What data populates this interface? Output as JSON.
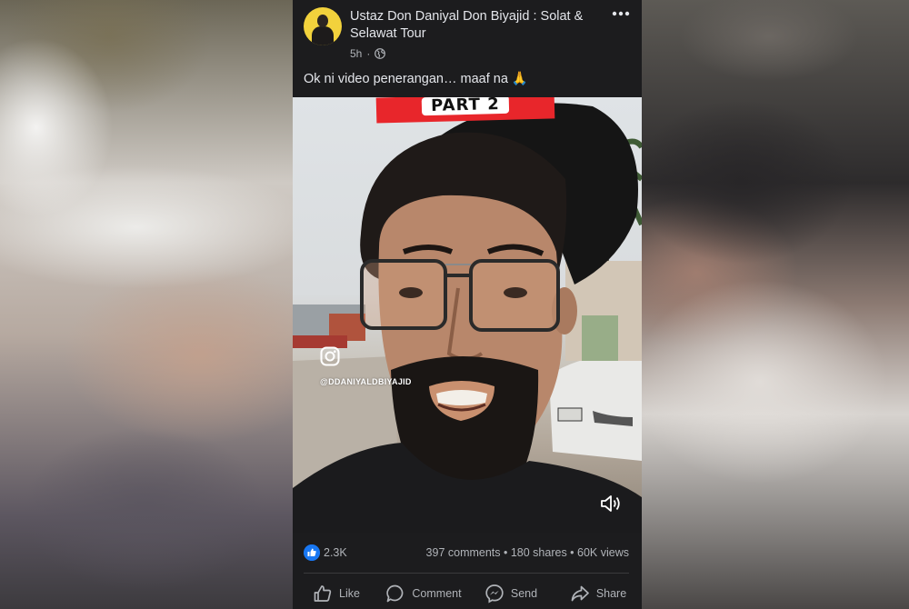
{
  "post": {
    "author": "Ustaz Don Daniyal Don Biyajid : Solat & Selawat Tour",
    "time": "5h",
    "separator": "·",
    "caption": "Ok ni video penerangan… maaf na 🙏",
    "video": {
      "banner_text": "PART 2",
      "overlay_handle": "@DDANIYALDBIYAJID"
    },
    "stats": {
      "reactions": "2.3K",
      "engagement": "397 comments • 180 shares • 60K views"
    },
    "actions": [
      {
        "label": "Like",
        "icon": "thumbs-up-icon"
      },
      {
        "label": "Comment",
        "icon": "comment-icon"
      },
      {
        "label": "Send",
        "icon": "messenger-icon"
      },
      {
        "label": "Share",
        "icon": "share-icon"
      }
    ]
  },
  "colors": {
    "panel_bg": "#1c1c1e",
    "text_primary": "#e4e6eb",
    "text_secondary": "#b0b3b8",
    "like_blue": "#1877f2",
    "banner_red": "#e8262b"
  }
}
